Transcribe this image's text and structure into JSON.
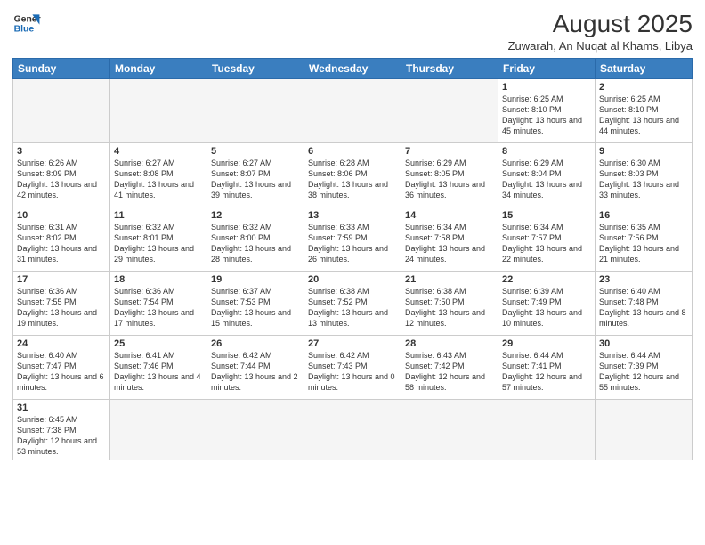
{
  "header": {
    "logo_line1": "General",
    "logo_line2": "Blue",
    "main_title": "August 2025",
    "subtitle": "Zuwarah, An Nuqat al Khams, Libya"
  },
  "weekdays": [
    "Sunday",
    "Monday",
    "Tuesday",
    "Wednesday",
    "Thursday",
    "Friday",
    "Saturday"
  ],
  "weeks": [
    [
      {
        "day": "",
        "info": ""
      },
      {
        "day": "",
        "info": ""
      },
      {
        "day": "",
        "info": ""
      },
      {
        "day": "",
        "info": ""
      },
      {
        "day": "",
        "info": ""
      },
      {
        "day": "1",
        "info": "Sunrise: 6:25 AM\nSunset: 8:10 PM\nDaylight: 13 hours and 45 minutes."
      },
      {
        "day": "2",
        "info": "Sunrise: 6:25 AM\nSunset: 8:10 PM\nDaylight: 13 hours and 44 minutes."
      }
    ],
    [
      {
        "day": "3",
        "info": "Sunrise: 6:26 AM\nSunset: 8:09 PM\nDaylight: 13 hours and 42 minutes."
      },
      {
        "day": "4",
        "info": "Sunrise: 6:27 AM\nSunset: 8:08 PM\nDaylight: 13 hours and 41 minutes."
      },
      {
        "day": "5",
        "info": "Sunrise: 6:27 AM\nSunset: 8:07 PM\nDaylight: 13 hours and 39 minutes."
      },
      {
        "day": "6",
        "info": "Sunrise: 6:28 AM\nSunset: 8:06 PM\nDaylight: 13 hours and 38 minutes."
      },
      {
        "day": "7",
        "info": "Sunrise: 6:29 AM\nSunset: 8:05 PM\nDaylight: 13 hours and 36 minutes."
      },
      {
        "day": "8",
        "info": "Sunrise: 6:29 AM\nSunset: 8:04 PM\nDaylight: 13 hours and 34 minutes."
      },
      {
        "day": "9",
        "info": "Sunrise: 6:30 AM\nSunset: 8:03 PM\nDaylight: 13 hours and 33 minutes."
      }
    ],
    [
      {
        "day": "10",
        "info": "Sunrise: 6:31 AM\nSunset: 8:02 PM\nDaylight: 13 hours and 31 minutes."
      },
      {
        "day": "11",
        "info": "Sunrise: 6:32 AM\nSunset: 8:01 PM\nDaylight: 13 hours and 29 minutes."
      },
      {
        "day": "12",
        "info": "Sunrise: 6:32 AM\nSunset: 8:00 PM\nDaylight: 13 hours and 28 minutes."
      },
      {
        "day": "13",
        "info": "Sunrise: 6:33 AM\nSunset: 7:59 PM\nDaylight: 13 hours and 26 minutes."
      },
      {
        "day": "14",
        "info": "Sunrise: 6:34 AM\nSunset: 7:58 PM\nDaylight: 13 hours and 24 minutes."
      },
      {
        "day": "15",
        "info": "Sunrise: 6:34 AM\nSunset: 7:57 PM\nDaylight: 13 hours and 22 minutes."
      },
      {
        "day": "16",
        "info": "Sunrise: 6:35 AM\nSunset: 7:56 PM\nDaylight: 13 hours and 21 minutes."
      }
    ],
    [
      {
        "day": "17",
        "info": "Sunrise: 6:36 AM\nSunset: 7:55 PM\nDaylight: 13 hours and 19 minutes."
      },
      {
        "day": "18",
        "info": "Sunrise: 6:36 AM\nSunset: 7:54 PM\nDaylight: 13 hours and 17 minutes."
      },
      {
        "day": "19",
        "info": "Sunrise: 6:37 AM\nSunset: 7:53 PM\nDaylight: 13 hours and 15 minutes."
      },
      {
        "day": "20",
        "info": "Sunrise: 6:38 AM\nSunset: 7:52 PM\nDaylight: 13 hours and 13 minutes."
      },
      {
        "day": "21",
        "info": "Sunrise: 6:38 AM\nSunset: 7:50 PM\nDaylight: 13 hours and 12 minutes."
      },
      {
        "day": "22",
        "info": "Sunrise: 6:39 AM\nSunset: 7:49 PM\nDaylight: 13 hours and 10 minutes."
      },
      {
        "day": "23",
        "info": "Sunrise: 6:40 AM\nSunset: 7:48 PM\nDaylight: 13 hours and 8 minutes."
      }
    ],
    [
      {
        "day": "24",
        "info": "Sunrise: 6:40 AM\nSunset: 7:47 PM\nDaylight: 13 hours and 6 minutes."
      },
      {
        "day": "25",
        "info": "Sunrise: 6:41 AM\nSunset: 7:46 PM\nDaylight: 13 hours and 4 minutes."
      },
      {
        "day": "26",
        "info": "Sunrise: 6:42 AM\nSunset: 7:44 PM\nDaylight: 13 hours and 2 minutes."
      },
      {
        "day": "27",
        "info": "Sunrise: 6:42 AM\nSunset: 7:43 PM\nDaylight: 13 hours and 0 minutes."
      },
      {
        "day": "28",
        "info": "Sunrise: 6:43 AM\nSunset: 7:42 PM\nDaylight: 12 hours and 58 minutes."
      },
      {
        "day": "29",
        "info": "Sunrise: 6:44 AM\nSunset: 7:41 PM\nDaylight: 12 hours and 57 minutes."
      },
      {
        "day": "30",
        "info": "Sunrise: 6:44 AM\nSunset: 7:39 PM\nDaylight: 12 hours and 55 minutes."
      }
    ],
    [
      {
        "day": "31",
        "info": "Sunrise: 6:45 AM\nSunset: 7:38 PM\nDaylight: 12 hours and 53 minutes."
      },
      {
        "day": "",
        "info": ""
      },
      {
        "day": "",
        "info": ""
      },
      {
        "day": "",
        "info": ""
      },
      {
        "day": "",
        "info": ""
      },
      {
        "day": "",
        "info": ""
      },
      {
        "day": "",
        "info": ""
      }
    ]
  ]
}
